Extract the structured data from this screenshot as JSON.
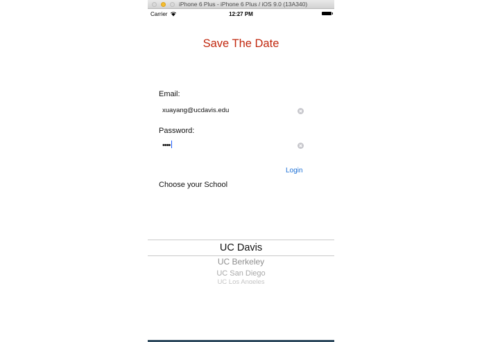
{
  "window": {
    "title": "iPhone 6 Plus - iPhone 6 Plus / iOS 9.0 (13A340)"
  },
  "status_bar": {
    "carrier": "Carrier",
    "time": "12:27 PM",
    "icons": [
      "wifi-icon",
      "battery-icon"
    ]
  },
  "app": {
    "title": "Save The Date",
    "title_color": "#c1270d"
  },
  "form": {
    "email_label": "Email:",
    "email_value": "xuayang@ucdavis.edu",
    "password_label": "Password:",
    "password_value": "••••",
    "login_label": "Login",
    "link_color": "#1a6fd6"
  },
  "school": {
    "label": "Choose your School",
    "options": [
      "UC Davis",
      "UC Berkeley",
      "UC San Diego",
      "UC Los Angeles"
    ],
    "selected": "UC Davis"
  }
}
